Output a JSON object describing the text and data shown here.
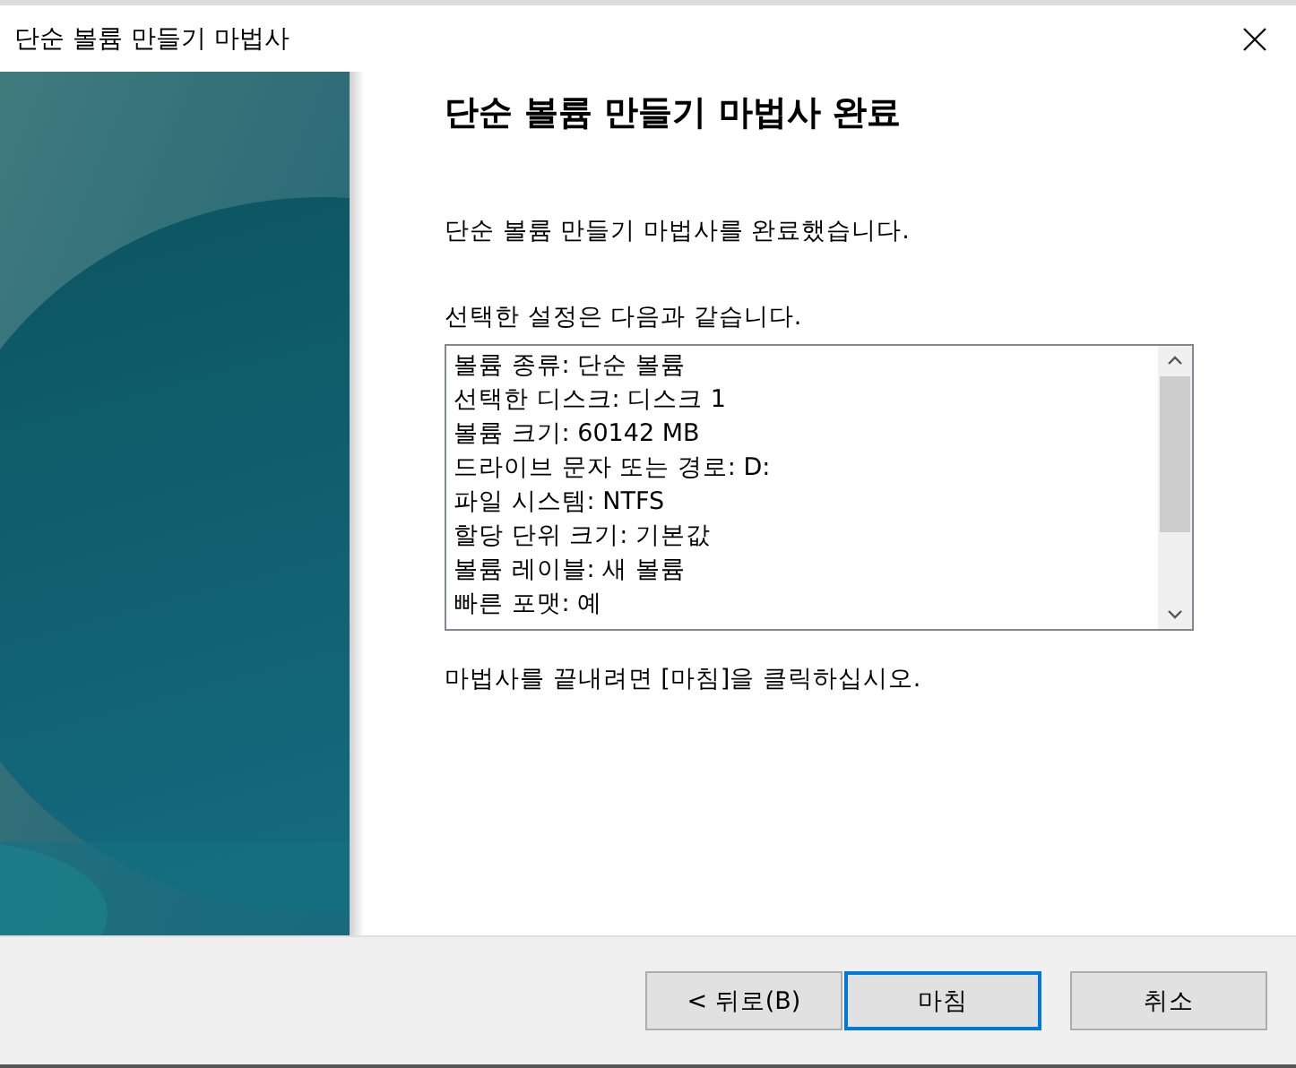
{
  "window": {
    "title": "단순 볼륨 만들기 마법사"
  },
  "heading": "단순 볼륨 만들기 마법사 완료",
  "completed_text": "단순 볼륨 만들기 마법사를 완료했습니다.",
  "settings_label": "선택한 설정은 다음과 같습니다.",
  "settings": [
    "볼륨 종류: 단순 볼륨",
    "선택한 디스크: 디스크 1",
    "볼륨 크기: 60142 MB",
    "드라이브 문자 또는 경로: D:",
    "파일 시스템: NTFS",
    "할당 단위 크기: 기본값",
    "볼륨 레이블: 새 볼륨",
    "빠른 포맷: 예"
  ],
  "finish_hint": "마법사를 끝내려면 [마침]을 클릭하십시오.",
  "buttons": [
    {
      "label": "< 뒤로(B)",
      "focused": false
    },
    {
      "label": "마침",
      "focused": true
    },
    {
      "label": "취소",
      "focused": false
    }
  ]
}
